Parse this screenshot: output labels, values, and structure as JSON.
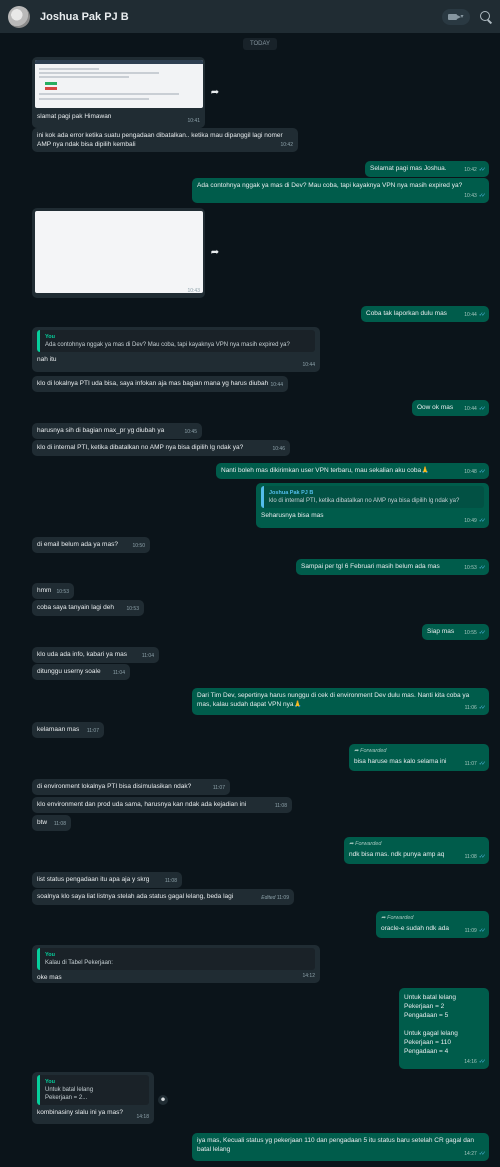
{
  "header": {
    "contact_name": "Joshua Pak PJ B",
    "video_caret": "▾",
    "icons": [
      "avatar",
      "video-call-icon",
      "search-icon"
    ]
  },
  "chat": {
    "day_label": "TODAY",
    "messages": [
      {
        "dir": "in",
        "type": "image",
        "caption": "slamat pagi pak Himawan",
        "time": "10:41"
      },
      {
        "dir": "in",
        "text": "ini kok ada error ketika suatu pengadaan dibatalkan.. ketika mau dipanggil lagi nomer AMP nya ndak bisa dipilih kembali",
        "time": "10:42"
      },
      {
        "dir": "out",
        "text": "Selamat pagi mas Joshua.",
        "time": "10:42"
      },
      {
        "dir": "out",
        "text": "Ada contohnya nggak ya mas di Dev? Mau coba, tapi kayaknya VPN nya masih expired ya?",
        "time": "10:43"
      },
      {
        "dir": "in",
        "type": "image",
        "time": "10:43"
      },
      {
        "dir": "out",
        "text": "Coba tak laporkan dulu mas",
        "time": "10:44"
      },
      {
        "dir": "in",
        "quote_name": "You",
        "quote_text": "Ada contohnya nggak ya mas di Dev? Mau coba, tapi kayaknya VPN nya masih expired ya?",
        "text": "nah itu",
        "time": "10:44"
      },
      {
        "dir": "in",
        "text": "klo di lokalnya PTI uda bisa, saya infokan aja mas bagian mana yg harus diubah",
        "time": "10:44"
      },
      {
        "dir": "out",
        "text": "Oow ok mas",
        "time": "10:44"
      },
      {
        "dir": "in",
        "text": "harusnya sih di bagian max_pr yg diubah ya",
        "time": "10:45"
      },
      {
        "dir": "in",
        "text": "klo di internal PTI, ketika dibatalkan no AMP nya bisa dipilih lg ndak ya?",
        "time": "10:46"
      },
      {
        "dir": "out",
        "text": "Nanti boleh mas dikirimkan user VPN terbaru, mau sekalian aku coba🙏",
        "time": "10:48"
      },
      {
        "dir": "out",
        "quote_name": "Joshua Pak PJ B",
        "quote_text": "klo di internal PTI, ketika dibatalkan no AMP nya bisa dipilih lg ndak ya?",
        "text": "Seharusnya bisa mas",
        "time": "10:49"
      },
      {
        "dir": "in",
        "text": "di email belum ada ya mas?",
        "time": "10:50"
      },
      {
        "dir": "out",
        "text": "Sampai per tgl 6 Februari masih belum ada mas",
        "time": "10:53"
      },
      {
        "dir": "in",
        "text": "hmm",
        "time": "10:53"
      },
      {
        "dir": "in",
        "text": "coba saya tanyain lagi deh",
        "time": "10:53"
      },
      {
        "dir": "out",
        "text": "Siap mas",
        "time": "10:55"
      },
      {
        "dir": "in",
        "text": "klo uda ada info, kabari ya mas",
        "time": "11:04"
      },
      {
        "dir": "in",
        "text": "ditunggu userny soale",
        "time": "11:04"
      },
      {
        "dir": "out",
        "text": "Dari Tim Dev, sepertinya harus nunggu di cek di environment Dev dulu mas. Nanti kita coba ya mas, kalau sudah dapat VPN nya🙏",
        "time": "11:06"
      },
      {
        "dir": "in",
        "text": "kelamaan mas",
        "time": "11:07"
      },
      {
        "dir": "out",
        "forwarded": "Forwarded",
        "text": "bisa haruse mas kalo selama ini",
        "time": "11:07"
      },
      {
        "dir": "in",
        "text": "di environment lokalnya PTI bisa disimulasikan ndak?",
        "time": "11:07"
      },
      {
        "dir": "in",
        "text": "klo environment dan prod uda sama, harusnya kan ndak ada kejadian ini",
        "time": "11:08"
      },
      {
        "dir": "in",
        "text": "btw",
        "time": "11:08"
      },
      {
        "dir": "out",
        "forwarded": "Forwarded",
        "text": "ndk bisa mas. ndk punya amp aq",
        "time": "11:08"
      },
      {
        "dir": "in",
        "text": "list status pengadaan itu apa aja y skrg",
        "time": "11:08"
      },
      {
        "dir": "in",
        "text": "soalnya klo saya liat listnya stelah ada status gagal lelang, beda lagi",
        "edited": "Edited",
        "time": "11:09"
      },
      {
        "dir": "out",
        "forwarded": "Forwarded",
        "text": "oracle-e sudah ndk ada",
        "time": "11:09"
      },
      {
        "dir": "in",
        "quote_name": "You",
        "quote_text": "Kalau di Tabel Pekerjaan:",
        "text": "oke mas",
        "time": "14:12"
      },
      {
        "dir": "out",
        "lines": [
          "Untuk batal lelang",
          "Pekerjaan = 2",
          "Pengadaan = 5",
          "",
          "Untuk gagal lelang",
          "Pekerjaan = 110",
          "Pengadaan = 4"
        ],
        "time": "14:16"
      },
      {
        "dir": "in",
        "quote_name": "You",
        "quote_text_lines": [
          "Untuk batal lelang",
          "Pekerjaan = 2..."
        ],
        "text": "kombinasiny slalu ini ya mas?",
        "time": "14:18",
        "reaction": "☻"
      },
      {
        "dir": "out",
        "text": "iya mas, Kecuali status yg pekerjaan 110 dan pengadaan 5 itu status baru setelah CR gagal dan batal lelang",
        "time": "14:27"
      }
    ]
  },
  "colors": {
    "background": "#0b141a",
    "incoming": "#202c33",
    "outgoing": "#005c4b",
    "read_check": "#53bdeb",
    "quote_bar": "#06cf9c"
  }
}
